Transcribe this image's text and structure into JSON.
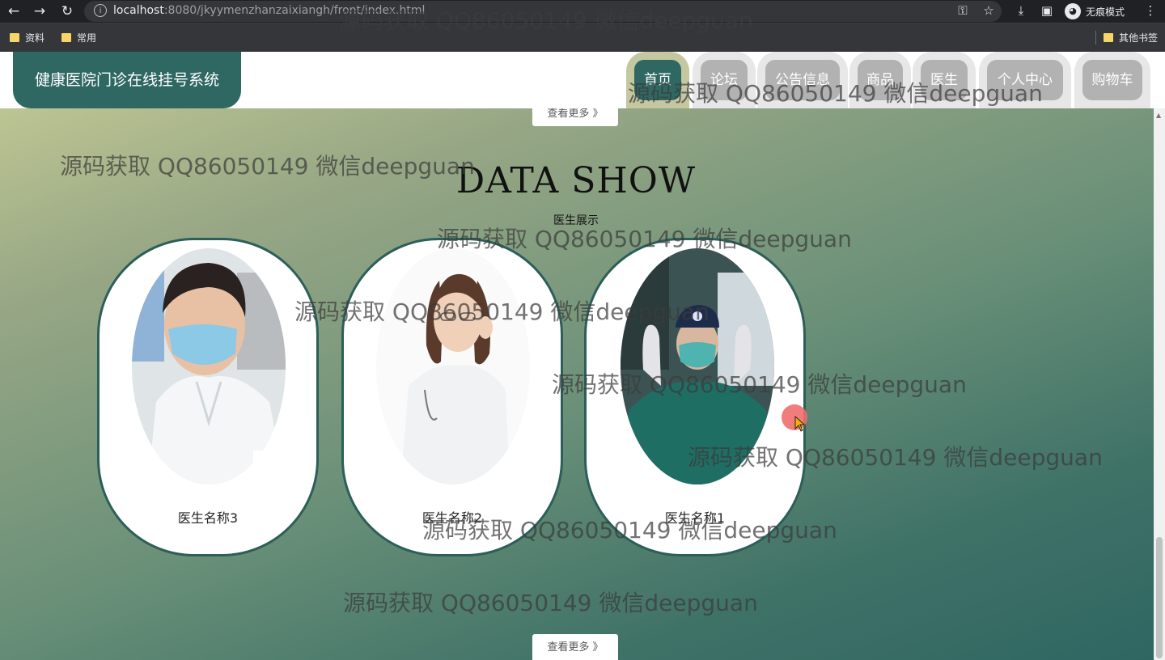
{
  "browser": {
    "url_host": "localhost",
    "url_rest": ":8080/jkyymenzhanzaixiangh/front/index.html",
    "incognito_label": "无痕模式",
    "bookmarks": [
      "资料",
      "常用"
    ],
    "other_bookmarks": "其他书签"
  },
  "header": {
    "site_title": "健康医院门诊在线挂号系统",
    "nav": [
      "首页",
      "论坛",
      "公告信息",
      "商品",
      "医生",
      "个人中心",
      "购物车"
    ],
    "active_nav": "首页"
  },
  "section": {
    "more_label_top": "查看更多 》",
    "title": "DATA SHOW",
    "subtitle": "医生展示",
    "doctors": [
      {
        "name": "医生名称3"
      },
      {
        "name": "医生名称2"
      },
      {
        "name": "医生名称1"
      }
    ],
    "more_label_bottom": "查看更多 》"
  },
  "watermark": {
    "text": "源码获取 QQ86050149 微信deepguan"
  },
  "colors": {
    "brand": "#2f6863",
    "nav_inactive": "#b2b2b2",
    "card_border": "#2c5f5a"
  }
}
